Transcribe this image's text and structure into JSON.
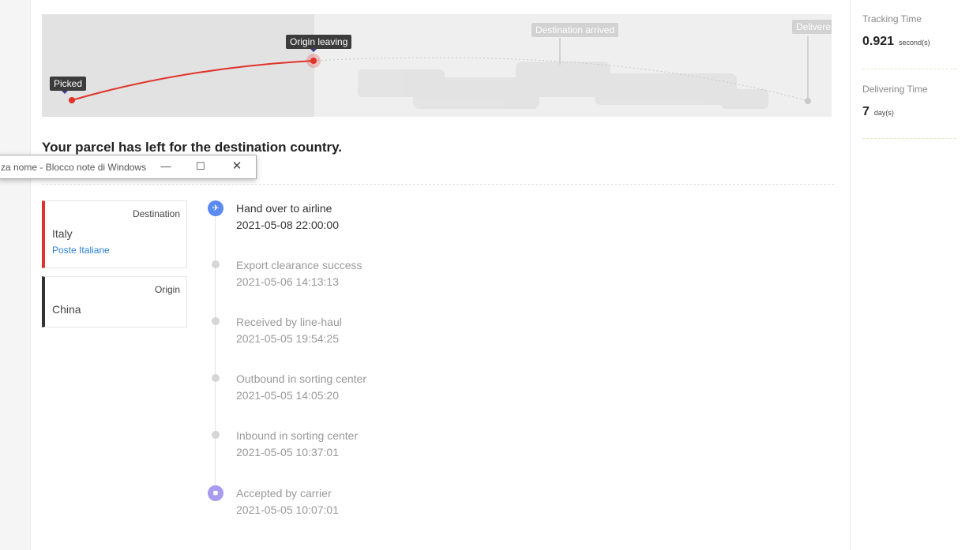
{
  "window": {
    "title": "za nome - Blocco note di Windows"
  },
  "map": {
    "milestones": [
      {
        "label": "Picked",
        "state": "done"
      },
      {
        "label": "Origin leaving",
        "state": "current"
      },
      {
        "label": "Destination arrived",
        "state": "pending"
      },
      {
        "label": "Delivere",
        "state": "pending"
      }
    ],
    "colors": {
      "active": "#e0322b",
      "pending": "#c8c8c8"
    }
  },
  "status": {
    "headline": "Your parcel has left for the destination country."
  },
  "cards": {
    "destination": {
      "type": "Destination",
      "country": "Italy",
      "carrier": "Poste Italiane",
      "accent": "#e0322b"
    },
    "origin": {
      "type": "Origin",
      "country": "China",
      "accent": "#333333"
    }
  },
  "events": [
    {
      "description": "Hand over to airline",
      "time": "2021-05-08 22:00:00",
      "icon": "airplane-icon"
    },
    {
      "description": "Export clearance success",
      "time": "2021-05-06 14:13:13"
    },
    {
      "description": "Received by line-haul",
      "time": "2021-05-05 19:54:25"
    },
    {
      "description": "Outbound in sorting center",
      "time": "2021-05-05 14:05:20"
    },
    {
      "description": "Inbound in sorting center",
      "time": "2021-05-05 10:37:01"
    },
    {
      "description": "Accepted by carrier",
      "time": "2021-05-05 10:07:01",
      "icon": "truck-icon"
    }
  ],
  "stats": {
    "tracking": {
      "label": "Tracking Time",
      "value": "0.921",
      "unit": "second(s)"
    },
    "delivering": {
      "label": "Delivering Time",
      "value": "7",
      "unit": "day(s)"
    }
  }
}
